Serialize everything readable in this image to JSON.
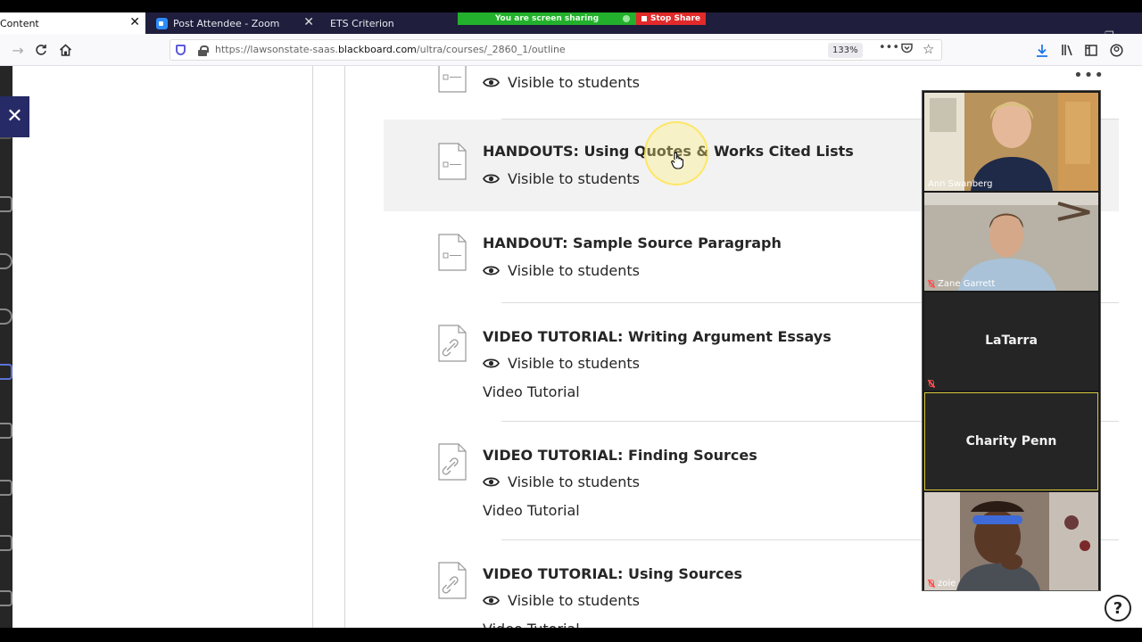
{
  "browser": {
    "tabs": [
      {
        "label": "Content",
        "active": true
      },
      {
        "label": "Post Attendee - Zoom",
        "active": false
      },
      {
        "label": "ETS Criterion",
        "active": false
      }
    ],
    "screen_share": {
      "status": "You are screen sharing",
      "stop_label": "Stop Share"
    },
    "url_prefix": "https://lawsonstate-saas.",
    "url_domain": "blackboard.com",
    "url_path": "/ultra/courses/_2860_1/outline",
    "zoom_level": "133%",
    "tab_close_glyph": "✕",
    "more_glyph": "•••",
    "help_glyph": "?",
    "close_glyph": "✕"
  },
  "content": {
    "items": [
      {
        "title": "",
        "visibility": "Visible to students",
        "description": "",
        "icon": "document-icon"
      },
      {
        "title": "HANDOUTS: Using Quotes & Works Cited Lists",
        "visibility": "Visible to students",
        "description": "",
        "icon": "document-icon"
      },
      {
        "title": "HANDOUT: Sample Source Paragraph",
        "visibility": "Visible to students",
        "description": "",
        "icon": "document-icon"
      },
      {
        "title": "VIDEO TUTORIAL: Writing Argument Essays",
        "visibility": "Visible to students",
        "description": "Video Tutorial",
        "icon": "link-icon"
      },
      {
        "title": "VIDEO TUTORIAL: Finding Sources",
        "visibility": "Visible to students",
        "description": "Video Tutorial",
        "icon": "link-icon"
      },
      {
        "title": "VIDEO TUTORIAL: Using Sources",
        "visibility": "Visible to students",
        "description": "Video Tutorial",
        "icon": "link-icon"
      }
    ]
  },
  "zoom_gallery": {
    "participants": [
      {
        "name": "Ann Swanberg",
        "muted": false,
        "video": true
      },
      {
        "name": "Zane Garrett",
        "muted": true,
        "video": true
      },
      {
        "name": "LaTarra",
        "muted": true,
        "video": false
      },
      {
        "name": "Charity Penn",
        "muted": false,
        "video": false
      },
      {
        "name": "zoie",
        "muted": true,
        "video": true
      }
    ]
  },
  "colors": {
    "tabbar": "#1f1e3d",
    "share_green": "#23b02c",
    "share_red": "#e22a2a",
    "close_panel": "#262a66",
    "active_speaker_border": "#d8c93a"
  }
}
